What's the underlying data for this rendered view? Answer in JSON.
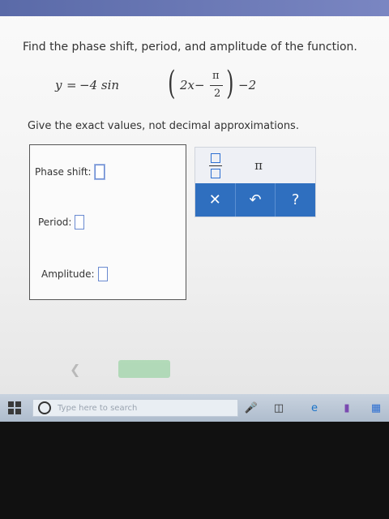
{
  "question": "Find the phase shift, period, and amplitude of the function.",
  "equation": {
    "lhs": "y",
    "eq": "=",
    "coef": "−4 sin",
    "inner": "2x−",
    "frac_num": "π",
    "frac_den": "2",
    "tail": "−2"
  },
  "instruction": "Give the exact values, not decimal approximations.",
  "fields": {
    "phase_shift_label": "Phase shift:",
    "period_label": "Period:",
    "amplitude_label": "Amplitude:"
  },
  "palette": {
    "pi": "π",
    "clear": "✕",
    "undo": "↶",
    "help": "?"
  },
  "taskbar": {
    "search_placeholder": "Type here to search"
  },
  "colors": {
    "palette_blue": "#2f6fbf",
    "input_border": "#6a8ad0",
    "top_bar": "#5a6aa8"
  }
}
